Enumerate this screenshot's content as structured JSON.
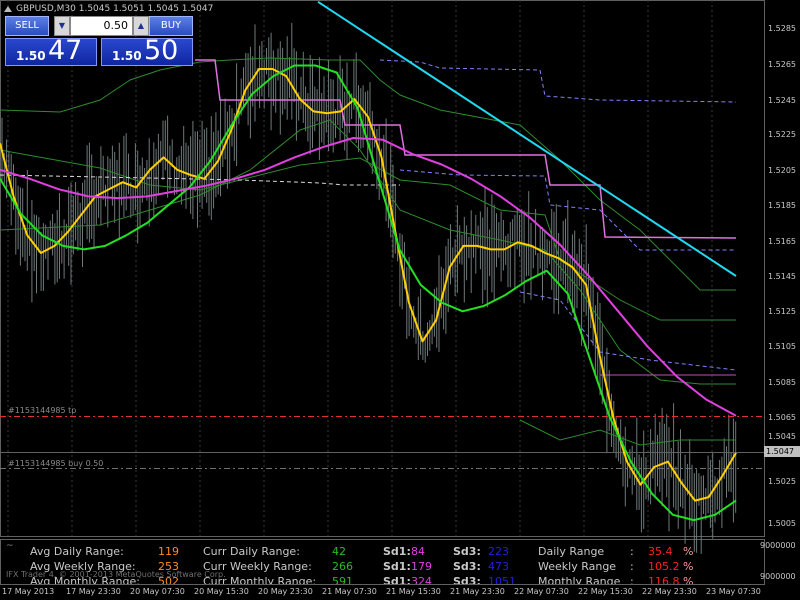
{
  "window": {
    "title": "GBPUSD,M30  1.5045 1.5051 1.5045 1.5047"
  },
  "trade_panel": {
    "sell_label": "SELL",
    "buy_label": "BUY",
    "lot_value": "0.50",
    "bid_small": "1.50",
    "bid_big": "47",
    "ask_small": "1.50",
    "ask_big": "50"
  },
  "price_axis": {
    "ticks": [
      "1.5285",
      "1.5265",
      "1.5245",
      "1.5225",
      "1.5205",
      "1.5185",
      "1.5165",
      "1.5145",
      "1.5125",
      "1.5105",
      "1.5085",
      "1.5065",
      "1.5045",
      "1.5025",
      "1.5005"
    ],
    "current_price": "1.5047"
  },
  "time_axis": {
    "labels": [
      "17 May 2013",
      "17 May 23:30",
      "20 May 07:30",
      "20 May 15:30",
      "20 May 23:30",
      "21 May 07:30",
      "21 May 15:30",
      "21 May 23:30",
      "22 May 07:30",
      "22 May 15:30",
      "22 May 23:30",
      "23 May 07:30",
      "23 May 15:30"
    ]
  },
  "orders": {
    "tp_label": "#1153144985 tp",
    "buy_label": "#1153144985 buy 0.50"
  },
  "indicator": {
    "scale_top": "9000000",
    "scale_bottom": "9000000",
    "rows": [
      {
        "a_label": "Avg Daily Range:",
        "a_value": "119",
        "b_label": "Curr Daily Range:",
        "b_value": "42",
        "sd1_label": "Sd1:",
        "sd1_value": "84",
        "sd3_label": "Sd3:",
        "sd3_value": "223",
        "r_label": "Daily Range",
        "r_colon": ":",
        "r_value": "35.4",
        "r_pct": "%"
      },
      {
        "a_label": "Avg Weekly Range:",
        "a_value": "253",
        "b_label": "Curr Weekly Range:",
        "b_value": "266",
        "sd1_label": "Sd1:",
        "sd1_value": "179",
        "sd3_label": "Sd3:",
        "sd3_value": "473",
        "r_label": "Weekly Range",
        "r_colon": ":",
        "r_value": "105.2",
        "r_pct": "%"
      },
      {
        "a_label": "Avg Monthly Range:",
        "a_value": "502",
        "b_label": "Curr Monthly Range:",
        "b_value": "591",
        "sd1_label": "Sd1:",
        "sd1_value": "324",
        "sd3_label": "Sd3:",
        "sd3_value": "1051",
        "r_label": "Monthly Range",
        "r_colon": ":",
        "r_value": "116.8",
        "r_pct": "%"
      }
    ],
    "watermark": "IFX Trader 4, © 2001-2013 MetaQuotes Software Corp."
  },
  "colors": {
    "background": "#000000",
    "yellow_ma": "#ffd000",
    "green_ma": "#22e022",
    "magenta_ma": "#e040e0",
    "cyan_trend": "#20d8f0",
    "order_tp": "#e03030"
  },
  "chart_data": {
    "type": "line",
    "ylim": [
      1.4998,
      1.5301
    ],
    "x_count": 96,
    "series": [
      {
        "key": "yellow_ma",
        "values": [
          1.522,
          1.519,
          1.5168,
          1.5158,
          1.5162,
          1.517,
          1.518,
          1.519,
          1.5194,
          1.5198,
          1.5195,
          1.5205,
          1.5212,
          1.5205,
          1.5202,
          1.52,
          1.521,
          1.5228,
          1.525,
          1.5262,
          1.5262,
          1.5258,
          1.5245,
          1.5238,
          1.5237,
          1.5238,
          1.5245,
          1.5235,
          1.5212,
          1.517,
          1.513,
          1.5108,
          1.512,
          1.515,
          1.5162,
          1.5162,
          1.516,
          1.516,
          1.5164,
          1.5162,
          1.5158,
          1.5155,
          1.515,
          1.514,
          1.51,
          1.5065,
          1.504,
          1.5027,
          1.5037,
          1.504,
          1.5028,
          1.5018,
          1.502,
          1.5032,
          1.5045
        ]
      },
      {
        "key": "green_ma",
        "values": [
          1.52,
          1.518,
          1.5168,
          1.5162,
          1.516,
          1.5162,
          1.5168,
          1.5175,
          1.5185,
          1.5195,
          1.521,
          1.523,
          1.5248,
          1.5258,
          1.5264,
          1.5264,
          1.526,
          1.524,
          1.52,
          1.516,
          1.514,
          1.513,
          1.5125,
          1.5128,
          1.5134,
          1.5142,
          1.5148,
          1.5135,
          1.51,
          1.5065,
          1.504,
          1.5022,
          1.501,
          1.5007,
          1.501,
          1.5018
        ]
      },
      {
        "key": "magenta_ma",
        "values": [
          1.5205,
          1.52,
          1.5194,
          1.519,
          1.5189,
          1.519,
          1.5193,
          1.5196,
          1.52,
          1.5205,
          1.5212,
          1.5218,
          1.5223,
          1.5222,
          1.5214,
          1.5208,
          1.52,
          1.519,
          1.5178,
          1.5163,
          1.5145,
          1.5125,
          1.5105,
          1.5088,
          1.5075,
          1.5066
        ]
      },
      {
        "key": "cyan_trend",
        "values": [
          1.53,
          1.5145
        ]
      }
    ]
  }
}
